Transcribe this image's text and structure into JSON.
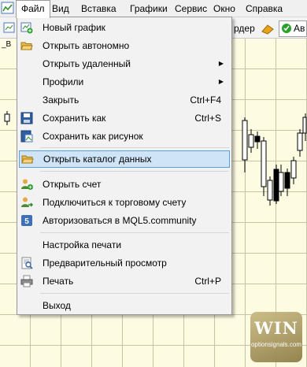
{
  "menubar": {
    "items": [
      "Файл",
      "Вид",
      "Вставка",
      "Графики",
      "Сервис",
      "Окно",
      "Справка"
    ]
  },
  "toolbar": {
    "partial_label_1": "рдер",
    "partial_label_2": "Ав"
  },
  "chart": {
    "tag": "_B"
  },
  "file_menu": {
    "items": [
      {
        "label": "Новый график",
        "shortcut": "",
        "icon": "new-chart-icon"
      },
      {
        "label": "Открыть автономно",
        "shortcut": "",
        "icon": "open-folder-icon"
      },
      {
        "label": "Открыть удаленный",
        "shortcut": "",
        "icon": "",
        "submenu": true
      },
      {
        "label": "Профили",
        "shortcut": "",
        "icon": "",
        "submenu": true
      },
      {
        "label": "Закрыть",
        "shortcut": "Ctrl+F4",
        "icon": ""
      },
      {
        "label": "Сохранить как",
        "shortcut": "Ctrl+S",
        "icon": "save-icon"
      },
      {
        "label": "Сохранить как рисунок",
        "shortcut": "",
        "icon": "save-picture-icon"
      },
      {
        "label": "Открыть каталог данных",
        "shortcut": "",
        "icon": "folder-icon",
        "highlighted": true
      },
      {
        "label": "Открыть счет",
        "shortcut": "",
        "icon": "add-user-icon"
      },
      {
        "label": "Подключиться к торговому счету",
        "shortcut": "",
        "icon": "connect-user-icon"
      },
      {
        "label": "Авторизоваться в MQL5.community",
        "shortcut": "",
        "icon": "mql5-icon"
      },
      {
        "label": "Настройка печати",
        "shortcut": "",
        "icon": ""
      },
      {
        "label": "Предварительный просмотр",
        "shortcut": "",
        "icon": "print-preview-icon"
      },
      {
        "label": "Печать",
        "shortcut": "Ctrl+P",
        "icon": "printer-icon"
      },
      {
        "label": "Выход",
        "shortcut": "",
        "icon": ""
      }
    ]
  },
  "watermark": {
    "big": "WIN",
    "small": "optionsignals.com"
  }
}
